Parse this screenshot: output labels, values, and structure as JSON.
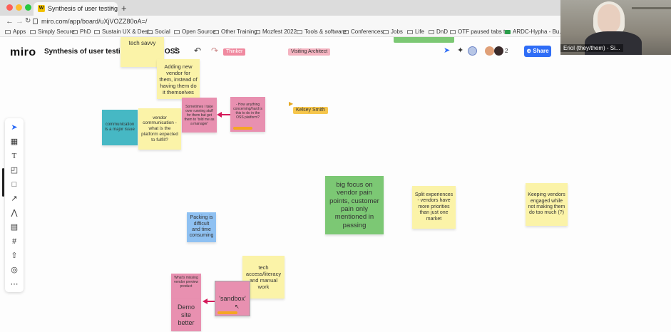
{
  "browser": {
    "tab_title": "Synthesis of user testing insig",
    "tab_favicon": "W",
    "tab_close": "×",
    "new_tab": "+",
    "url": "miro.com/app/board/uXjVOZZ80oA=/",
    "bookmarks": [
      "Apps",
      "Simply Secure",
      "PhD",
      "Sustain UX & Desi...",
      "Social",
      "Open Source",
      "Other Training",
      "Mozfest 2022",
      "Tools & software",
      "Conferences",
      "Jobs",
      "Life",
      "DnD",
      "OTF paused tabs t...",
      "ARDC-Hypha - Bu..."
    ]
  },
  "miro": {
    "logo": "miro",
    "board_title": "Synthesis of user testing insight in OSS",
    "share_label": "Share",
    "collaborator_count": "2",
    "cursor_labels": [
      "Thinker",
      "Visiting Architect",
      "Kelsey Smith"
    ]
  },
  "webcam": {
    "name": "Eriol (they/them) - Si..."
  },
  "stickies": [
    {
      "text": "tech savvy",
      "color": "#fbf3a8"
    },
    {
      "text": "Adding new vendor for them, instead of having them do it themselves",
      "color": "#fbf3a8"
    },
    {
      "text": "Sometimes I take over running stuff for them but get them to 'told me as a manager'",
      "color": "#e890b0"
    },
    {
      "text": "- How anything concerning/hard is this to do in the OSS platform?",
      "color": "#e890b0"
    },
    {
      "text": "communication is a major issue",
      "color": "#46b8c4"
    },
    {
      "text": "vendor communication - what is the platform expected to fulfill?",
      "color": "#fbf3a8"
    },
    {
      "text": "big focus on vendor pain points, customer pain only mentioned in passing",
      "color": "#7cc874"
    },
    {
      "text": "Split experiences - vendors have more priorities than just one market",
      "color": "#fbf3a8"
    },
    {
      "text": "Keeping vendors engaged while not making them do too much (?)",
      "color": "#fbf3a8"
    },
    {
      "text": "Packing is difficult and time consuming",
      "color": "#8fc1f2"
    },
    {
      "text": "tech access/literacy and manual work",
      "color": "#fbf3a8"
    },
    {
      "text": "What's missing vendor preview product",
      "color": "#e890b0"
    },
    {
      "text": "Demo site better",
      "color": "#e890b0"
    },
    {
      "text": "'sandbox'",
      "color": "#e890b0"
    }
  ]
}
